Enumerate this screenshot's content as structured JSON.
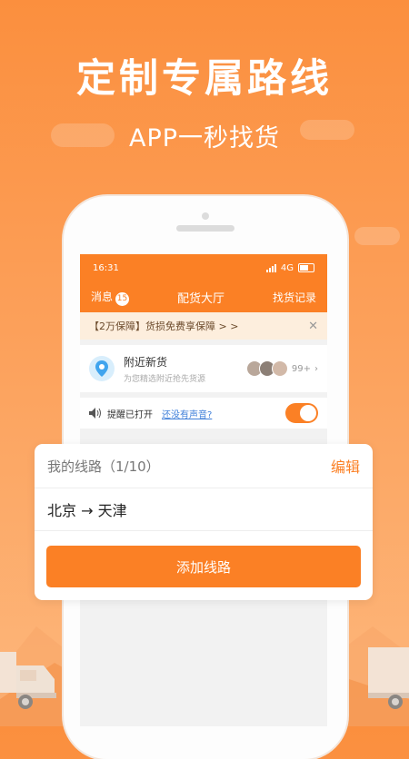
{
  "hero": {
    "headline": "定制专属路线",
    "subline": "APP一秒找货"
  },
  "status_bar": {
    "time": "16:31",
    "network": "4G"
  },
  "nav": {
    "messages_label": "消息",
    "messages_count": "15",
    "title": "配货大厅",
    "history_label": "找货记录"
  },
  "promo": {
    "text": "【2万保障】货损免费享保障 > >",
    "close": "✕"
  },
  "nearby": {
    "title": "附近新货",
    "subtitle": "为您精选附近抢先货源",
    "count": "99+"
  },
  "alert": {
    "status": "提醒已打开",
    "help_link": "还没有声音?",
    "toggle_on": true
  },
  "routes_card": {
    "label": "我的线路（1/10）",
    "edit_label": "编辑",
    "routes": [
      {
        "text": "北京 → 天津"
      }
    ],
    "add_button": "添加线路"
  },
  "colors": {
    "accent": "#fb8025",
    "promo_bg": "#fdeedd",
    "link": "#3f7fd9"
  }
}
